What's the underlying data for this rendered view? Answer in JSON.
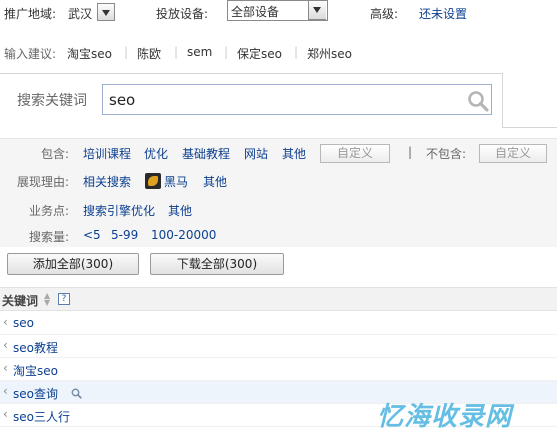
{
  "top_bar": {
    "region_label": "推广地域:",
    "region_value": "武汉",
    "device_label": "投放设备:",
    "device_value": "全部设备",
    "advanced_label": "高级:",
    "advanced_link": "还未设置"
  },
  "suggestions": {
    "label": "输入建议:",
    "items": [
      "淘宝seo",
      "陈欧",
      "sem",
      "保定seo",
      "郑州seo"
    ]
  },
  "search": {
    "label": "搜索关键词",
    "value": "seo"
  },
  "filters": {
    "include_label": "包含:",
    "include_items": [
      "培训课程",
      "优化",
      "基础教程",
      "网站",
      "其他"
    ],
    "include_custom": "自定义",
    "divider": "|",
    "exclude_label": "不包含:",
    "exclude_custom": "自定义",
    "reason_label": "展现理由:",
    "reason_items": [
      "相关搜索",
      "黑马",
      "其他"
    ],
    "business_label": "业务点:",
    "business_items": [
      "搜索引擎优化",
      "其他"
    ],
    "volume_label": "搜索量:",
    "volume_items": [
      "<5",
      "5-99",
      "100-20000"
    ]
  },
  "actions": {
    "add_all": "添加全部(300)",
    "download_all": "下载全部(300)"
  },
  "keyword_table": {
    "header": "关键词",
    "help": "?",
    "rows": [
      "seo",
      "seo教程",
      "淘宝seo",
      "seo查询",
      "seo三人行"
    ]
  },
  "watermark": "忆海收录网",
  "colors": {
    "link": "#0b3f8f",
    "panel_bg": "#f5f5f5",
    "watermark": "#55b7e0"
  }
}
